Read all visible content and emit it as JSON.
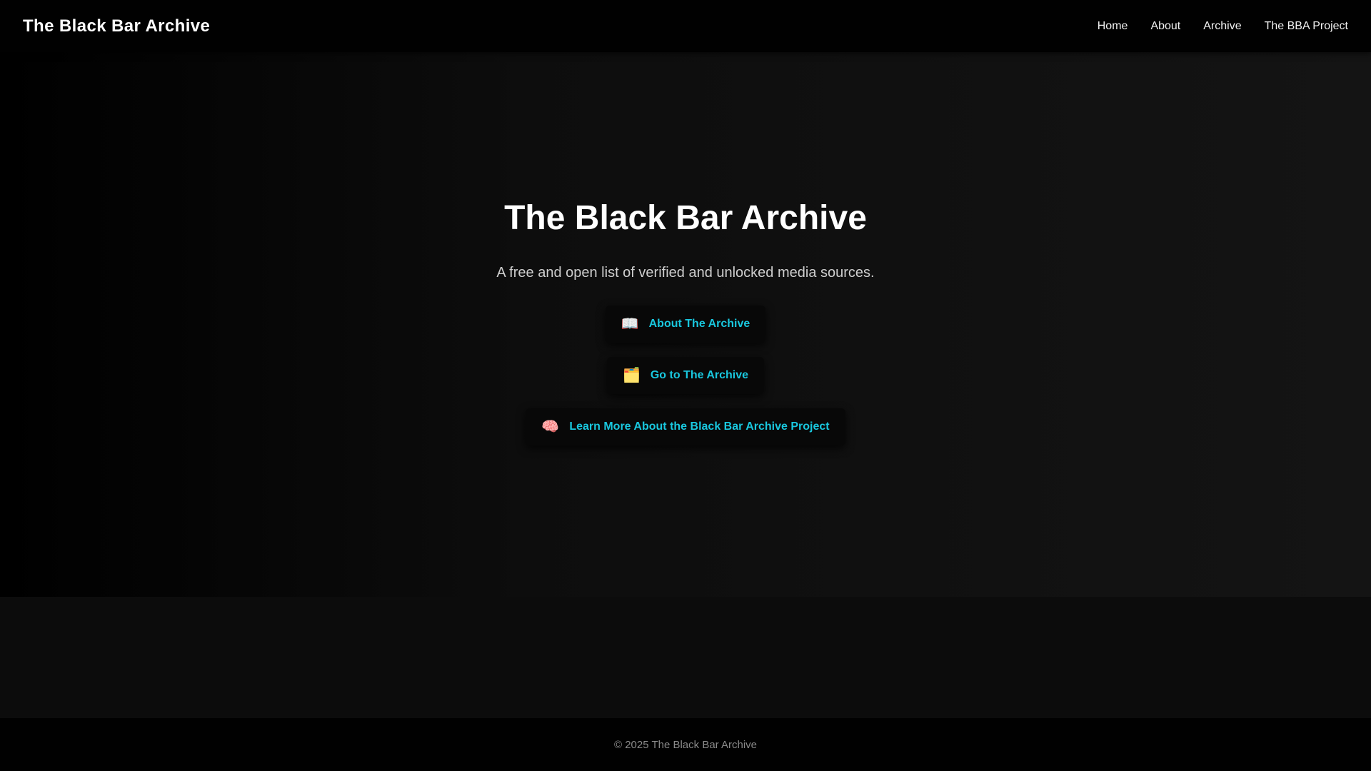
{
  "header": {
    "brand": "The Black Bar Archive",
    "nav": {
      "home": "Home",
      "about": "About",
      "archive": "Archive",
      "project": "The BBA Project"
    }
  },
  "hero": {
    "title": "The Black Bar Archive",
    "subtitle": "A free and open list of verified and unlocked media sources.",
    "buttons": [
      {
        "icon": "open-book-icon",
        "glyph": "📖",
        "label": "About The Archive"
      },
      {
        "icon": "card-index-dividers-icon",
        "glyph": "🗂️",
        "label": "Go to The Archive"
      },
      {
        "icon": "brain-icon",
        "glyph": "🧠",
        "label": "Learn More About the Black Bar Archive Project"
      }
    ]
  },
  "footer": {
    "copyright": "© 2025 The Black Bar Archive"
  },
  "colors": {
    "accent": "#19c7de",
    "background": "#0b0b0b",
    "header": "#010101"
  }
}
